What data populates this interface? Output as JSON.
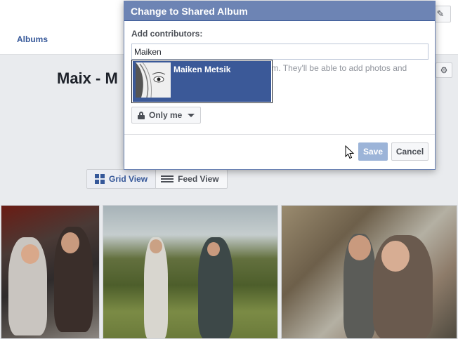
{
  "background": {
    "albums_link": "Albums",
    "album_title": "Maix - M",
    "description_fragment": "oum. They'll be able to add photos and\nes.",
    "view_toggle": {
      "grid_label": "Grid View",
      "feed_label": "Feed View"
    },
    "icons": {
      "edit": "pencil-icon",
      "settings": "gear-icon"
    },
    "photos": [
      {
        "desc": "two people in a bus"
      },
      {
        "desc": "people in a green field"
      },
      {
        "desc": "two people in a shop"
      }
    ]
  },
  "modal": {
    "title": "Change to Shared Album",
    "add_contributors_label": "Add contributors:",
    "contributor_input_value": "Maiken",
    "suggestion": {
      "name": "Maiken Metsik"
    },
    "privacy": {
      "label": "Only me",
      "icon": "lock-icon"
    },
    "save_label": "Save",
    "cancel_label": "Cancel"
  },
  "colors": {
    "header_blue": "#6d84b4",
    "selection_blue": "#3b5998",
    "link_blue": "#365899",
    "save_disabled": "#9cb4d8"
  }
}
